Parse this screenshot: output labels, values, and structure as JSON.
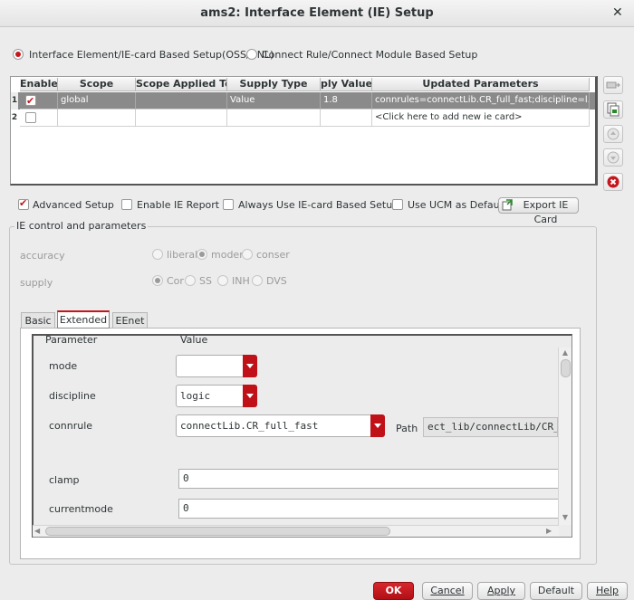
{
  "window": {
    "title": "ams2: Interface Element (IE) Setup",
    "close_glyph": "✕"
  },
  "mode_radios": [
    {
      "label": "Interface Element/IE-card Based Setup(OSS/UNL)",
      "selected": true
    },
    {
      "label": "Connect Rule/Connect Module Based Setup",
      "selected": false
    }
  ],
  "ie_table": {
    "headers": [
      "Enable",
      "Scope",
      "Scope Applied To",
      "Supply Type",
      "ply Value/I",
      "Updated Parameters"
    ],
    "rows": [
      {
        "num": "1",
        "enabled": true,
        "scope": "global",
        "applied_to": "",
        "supply_type": "Value",
        "supply_value": "1.8",
        "params": "connrules=connectLib.CR_full_fast;discipline=l..."
      },
      {
        "num": "2",
        "enabled": false,
        "scope": "",
        "applied_to": "",
        "supply_type": "",
        "supply_value": "",
        "params": "<Click here to add new ie card>"
      }
    ]
  },
  "side_buttons": [
    "delete-card-icon",
    "copy-card-icon",
    "move-up-icon",
    "move-down-icon",
    "remove-icon"
  ],
  "options": {
    "advanced_setup": {
      "label": "Advanced Setup",
      "checked": true
    },
    "enable_ie_report": {
      "label": "Enable IE Report",
      "checked": false
    },
    "always_use_iecard": {
      "label": "Always Use IE-card Based Setup",
      "checked": false
    },
    "use_ucm": {
      "label": "Use UCM as Default",
      "checked": false
    },
    "export_label": "Export IE Card"
  },
  "group": {
    "title": "IE control and parameters",
    "accuracy": {
      "label": "accuracy",
      "options": [
        "liberal",
        "moder",
        "conser"
      ],
      "selected": 1
    },
    "supply": {
      "label": "supply",
      "options": [
        "Cor",
        "SS",
        "INH",
        "DVS"
      ],
      "selected": 0
    }
  },
  "tabs": [
    "Basic",
    "Extended",
    "EEnet"
  ],
  "active_tab": "Extended",
  "param_table": {
    "col_parameter": "Parameter",
    "col_value": "Value",
    "mode": {
      "label": "mode",
      "value": ""
    },
    "discipline": {
      "label": "discipline",
      "value": "logic"
    },
    "connrule": {
      "label": "connrule",
      "value": "connectLib.CR_full_fast",
      "path_label": "Path",
      "path_value": "ect_lib/connectLib/CR_"
    },
    "clamp": {
      "label": "clamp",
      "value": "0"
    },
    "currentmode": {
      "label": "currentmode",
      "value": "0"
    }
  },
  "buttons": {
    "ok": "OK",
    "cancel": "Cancel",
    "apply": "Apply",
    "default": "Default",
    "help": "Help"
  },
  "colors": {
    "accent": "#c4161c",
    "selected_row": "#8a8a8a"
  }
}
